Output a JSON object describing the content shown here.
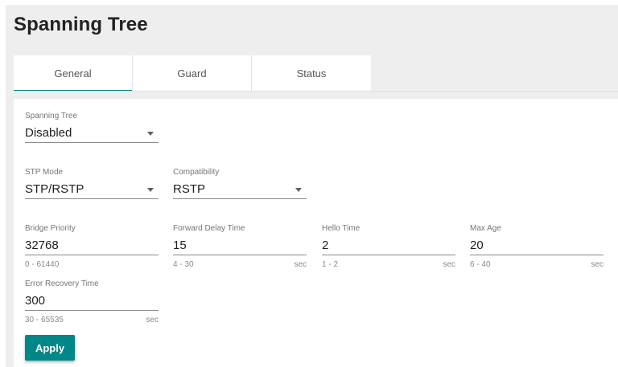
{
  "page": {
    "title": "Spanning Tree"
  },
  "tabs": [
    {
      "label": "General",
      "active": true
    },
    {
      "label": "Guard",
      "active": false
    },
    {
      "label": "Status",
      "active": false
    }
  ],
  "form": {
    "spanning_tree": {
      "label": "Spanning Tree",
      "value": "Disabled"
    },
    "stp_mode": {
      "label": "STP Mode",
      "value": "STP/RSTP"
    },
    "compatibility": {
      "label": "Compatibility",
      "value": "RSTP"
    },
    "bridge_priority": {
      "label": "Bridge Priority",
      "value": "32768",
      "range": "0 - 61440",
      "unit": ""
    },
    "forward_delay_time": {
      "label": "Forward Delay Time",
      "value": "15",
      "range": "4 - 30",
      "unit": "sec"
    },
    "hello_time": {
      "label": "Hello Time",
      "value": "2",
      "range": "1 - 2",
      "unit": "sec"
    },
    "max_age": {
      "label": "Max Age",
      "value": "20",
      "range": "6 - 40",
      "unit": "sec"
    },
    "error_recovery_time": {
      "label": "Error Recovery Time",
      "value": "300",
      "range": "30 - 65535",
      "unit": "sec"
    }
  },
  "actions": {
    "apply_label": "Apply"
  },
  "colors": {
    "accent": "#008787",
    "page_background": "#eeeeee",
    "card_background": "#ffffff"
  },
  "icons": {
    "dropdown": "caret-down-icon"
  }
}
